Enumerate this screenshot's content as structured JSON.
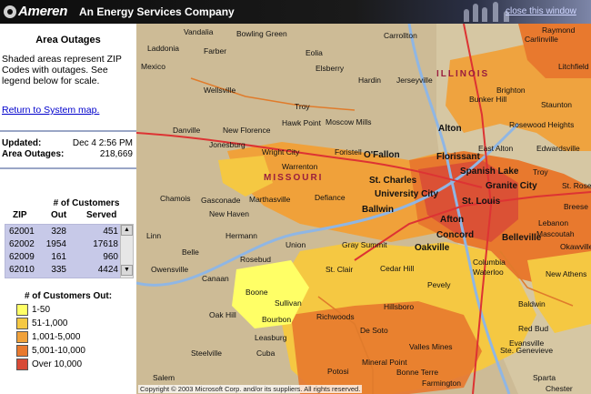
{
  "header": {
    "logo": "Ameren",
    "tagline": "An Energy Services Company",
    "close_link": "close this window"
  },
  "sidebar": {
    "title": "Area Outages",
    "description": "Shaded areas represent ZIP Codes with outages.  See legend below for scale.",
    "return_link": "Return to System map.",
    "updated_label": "Updated:",
    "updated_value": "Dec 4 2:56 PM",
    "outages_label": "Area Outages:",
    "outages_value": "218,669",
    "table": {
      "caption": "# of Customers",
      "headers": [
        "ZIP",
        "Out",
        "Served"
      ],
      "rows": [
        [
          "62001",
          "328",
          "451"
        ],
        [
          "62002",
          "1954",
          "17618"
        ],
        [
          "62009",
          "161",
          "960"
        ],
        [
          "62010",
          "335",
          "4424"
        ]
      ]
    },
    "legend": {
      "title": "# of Customers Out:",
      "items": [
        {
          "label": "1-50",
          "color": "#ffff66"
        },
        {
          "label": "51-1,000",
          "color": "#f5c842"
        },
        {
          "label": "1,001-5,000",
          "color": "#f0a13a"
        },
        {
          "label": "5,001-10,000",
          "color": "#e8792e"
        },
        {
          "label": "Over 10,000",
          "color": "#d84a36"
        }
      ]
    }
  },
  "map": {
    "copyright": "Copyright © 2003 Microsoft Corp. and/or its suppliers. All rights reserved.",
    "state_labels": [
      "ILLINOIS",
      "MISSOURI"
    ],
    "cities": [
      "Vandalia",
      "Bowling Green",
      "Carrollton",
      "Carlinville",
      "Raymond",
      "Laddonia",
      "Farber",
      "Eolia",
      "Mexico",
      "Elsberry",
      "Hardin",
      "Jerseyville",
      "Litchfield",
      "Wellsville",
      "Brighton",
      "Bunker Hill",
      "Staunton",
      "Troy",
      "Alton",
      "Moscow Mills",
      "Rosewood Heights",
      "Danville",
      "New Florence",
      "Hawk Point",
      "Wright City",
      "Foristell",
      "O'Fallon",
      "Florissant",
      "East Alton",
      "Edwardsville",
      "Jonesburg",
      "Warrenton",
      "St. Charles",
      "Spanish Lake",
      "Granite City",
      "Troy",
      "St. Rose",
      "Chamois",
      "Gasconade",
      "Marthasville",
      "Defiance",
      "University City",
      "St. Louis",
      "Breese",
      "New Haven",
      "Ballwin",
      "Afton",
      "Lebanon",
      "Mascoutah",
      "Linn",
      "Hermann",
      "Union",
      "Gray Summit",
      "Concord",
      "Oakville",
      "Belleville",
      "Okawville",
      "Belle",
      "Rosebud",
      "St. Clair",
      "Cedar Hill",
      "Columbia",
      "Waterloo",
      "New Athens",
      "Owensville",
      "Canaan",
      "Sullivan",
      "Boone",
      "Hillsboro",
      "Pevely",
      "Baldwin",
      "Oak Hill",
      "Bourbon",
      "Richwoods",
      "De Soto",
      "Red Bud",
      "Steelville",
      "Leasburg",
      "Cuba",
      "Valles Mines",
      "Ste. Genevieve",
      "Evansville",
      "Salem",
      "Potosi",
      "Mineral Point",
      "Bonne Terre",
      "Farmington",
      "Sparta",
      "Chester"
    ]
  }
}
